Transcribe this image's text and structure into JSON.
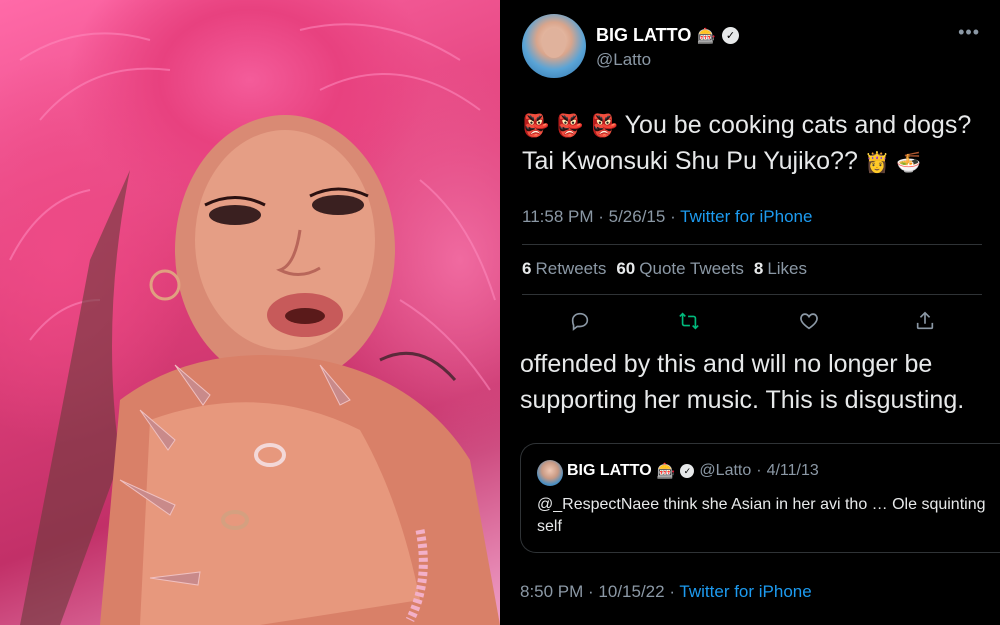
{
  "tweet": {
    "display_name": "BIG LATTO",
    "name_emoji": "🎰",
    "handle": "@Latto",
    "more_icon": "more-dots-icon",
    "text_emoji": "👺 👺 👺",
    "text": "You be cooking cats and dogs? Tai Kwonsuki Shu Pu Yujiko??",
    "text_end_emoji": "👸 🍜",
    "time": "11:58 PM",
    "date": "5/26/15",
    "source": "Twitter for iPhone",
    "stats": {
      "retweets_count": "6",
      "retweets_label": "Retweets",
      "quotes_count": "60",
      "quotes_label": "Quote Tweets",
      "likes_count": "8",
      "likes_label": "Likes"
    },
    "actions": [
      "reply-icon",
      "retweet-icon",
      "like-icon",
      "share-icon"
    ]
  },
  "reply": {
    "text": "offended by this and will no longer be supporting her music. This is disgusting.",
    "time": "8:50 PM",
    "date": "10/15/22",
    "source": "Twitter for iPhone"
  },
  "quoted": {
    "display_name": "BIG LATTO",
    "name_emoji": "🎰",
    "handle": "@Latto",
    "date": "4/11/13",
    "text": "@_RespectNaee think she Asian in her avi tho … Ole squinting self"
  },
  "colors": {
    "background": "#000000",
    "text": "#e7e9ea",
    "muted": "#8b98a5",
    "link": "#1d9bf0",
    "retweet_green": "#00ba7c",
    "divider": "#2f3336"
  }
}
